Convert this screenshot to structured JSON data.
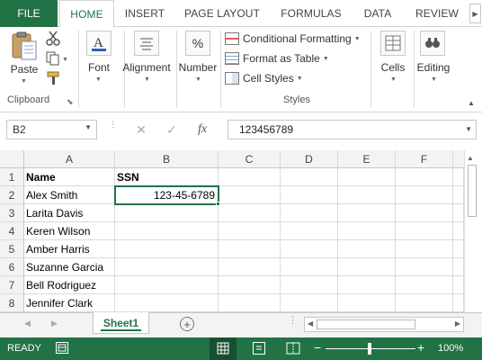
{
  "ribbon_tabs": [
    "FILE",
    "HOME",
    "INSERT",
    "PAGE LAYOUT",
    "FORMULAS",
    "DATA",
    "REVIEW"
  ],
  "ribbon": {
    "paste_label": "Paste",
    "clipboard_label": "Clipboard",
    "font_label": "Font",
    "alignment_label": "Alignment",
    "number_label": "Number",
    "number_icon_text": "%",
    "conditional_formatting": "Conditional Formatting",
    "format_as_table": "Format as Table",
    "cell_styles": "Cell Styles",
    "styles_label": "Styles",
    "cells_label": "Cells",
    "editing_label": "Editing"
  },
  "formula_bar": {
    "name_box": "B2",
    "fx_label": "fx",
    "value": "123456789"
  },
  "grid": {
    "columns": [
      "A",
      "B",
      "C",
      "D",
      "E",
      "F"
    ],
    "rows": [
      {
        "num": "1",
        "a": "Name",
        "b": "SSN"
      },
      {
        "num": "2",
        "a": "Alex Smith",
        "b": "123-45-6789"
      },
      {
        "num": "3",
        "a": "Larita Davis",
        "b": ""
      },
      {
        "num": "4",
        "a": "Keren Wilson",
        "b": ""
      },
      {
        "num": "5",
        "a": "Amber Harris",
        "b": ""
      },
      {
        "num": "6",
        "a": "Suzanne Garcia",
        "b": ""
      },
      {
        "num": "7",
        "a": "Bell Rodriguez",
        "b": ""
      },
      {
        "num": "8",
        "a": "Jennifer Clark",
        "b": ""
      }
    ]
  },
  "sheets": {
    "active": "Sheet1"
  },
  "status": {
    "ready": "READY",
    "zoom": "100%"
  },
  "colors": {
    "accent": "#217346"
  }
}
